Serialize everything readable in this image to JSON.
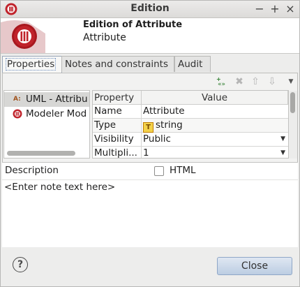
{
  "window": {
    "title": "Edition",
    "controls": [
      "−",
      "+",
      "×"
    ]
  },
  "header": {
    "title": "Edition of Attribute",
    "subtitle": "Attribute"
  },
  "tabs": [
    {
      "label": "Properties",
      "active": true
    },
    {
      "label": "Notes and constraints",
      "active": false
    },
    {
      "label": "Audit",
      "active": false
    }
  ],
  "toolbar": {
    "icons": [
      "add-stereotype-icon",
      "delete-icon",
      "move-up-icon",
      "move-down-icon",
      "menu-arrow-icon"
    ]
  },
  "tree": {
    "items": [
      {
        "label": "UML - Attribu",
        "icon": "uml-attribute-icon",
        "selected": true
      },
      {
        "label": "Modeler Mod",
        "icon": "modeler-module-icon",
        "selected": false
      }
    ]
  },
  "table": {
    "headers": {
      "property": "Property",
      "value": "Value"
    },
    "rows": [
      {
        "property": "Name",
        "value": "Attribute"
      },
      {
        "property": "Type",
        "value": "string",
        "icon": "T"
      },
      {
        "property": "Visibility",
        "value": "Public"
      },
      {
        "property": "Multipli...",
        "value": "1"
      }
    ]
  },
  "description": {
    "label": "Description",
    "html_label": "HTML",
    "html_checked": false,
    "placeholder": "<Enter note text here>"
  },
  "footer": {
    "help_icon": "?",
    "close_label": "Close"
  },
  "colors": {
    "modelio_red": "#c0232b",
    "selection": "#d7d7d5",
    "close_button": "#c6d5e8"
  }
}
